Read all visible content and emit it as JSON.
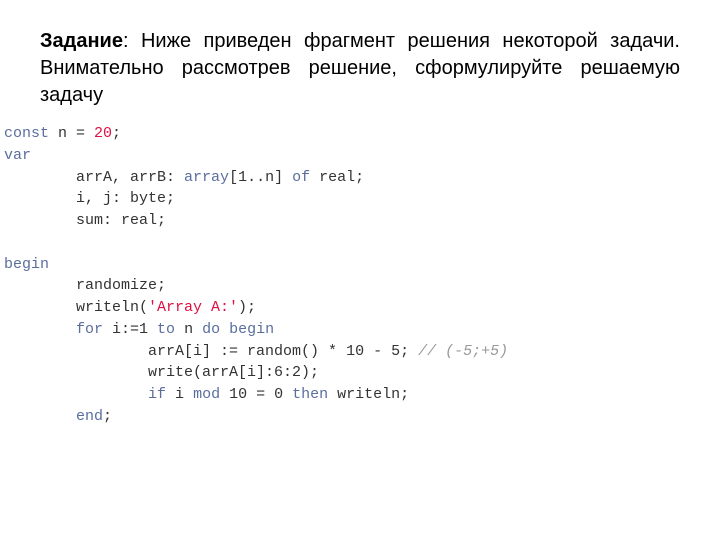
{
  "task": {
    "label": "Задание",
    "colon": ": ",
    "text": "Ниже приведен фрагмент решения некоторой задачи. Внимательно рассмотрев решение, сформулируйте решаемую задачу"
  },
  "code": {
    "l1": {
      "kw1": "const",
      "rest": " n = ",
      "num": "20",
      "semi": ";"
    },
    "l2": {
      "kw1": "var"
    },
    "l3": {
      "indent": "        ",
      "part1": "arrA, arrB: ",
      "kw1": "array",
      "part2": "[1..n] ",
      "kw2": "of",
      "part3": " real;"
    },
    "l4": {
      "indent": "        ",
      "part1": "i, j: byte;"
    },
    "l5": {
      "indent": "        ",
      "part1": "sum: real;"
    },
    "blank1": "",
    "l6": {
      "kw1": "begin"
    },
    "l7": {
      "indent": "        ",
      "part1": "randomize;"
    },
    "l8": {
      "indent": "        ",
      "part1": "writeln(",
      "str": "'Array A:'",
      "part2": ");"
    },
    "l9": {
      "indent": "        ",
      "kw1": "for",
      "part1": " i:=1 ",
      "kw2": "to",
      "part2": " n ",
      "kw3": "do",
      "part3": " ",
      "kw4": "begin"
    },
    "l10": {
      "indent": "                ",
      "part1": "arrA[i] := random() * 10 - 5; ",
      "cmt": "// (-5;+5)"
    },
    "l11": {
      "indent": "                ",
      "part1": "write(arrA[i]:6:2);"
    },
    "l12": {
      "indent": "                ",
      "kw1": "if",
      "part1": " i ",
      "kw2": "mod",
      "part2": " 10 = 0 ",
      "kw3": "then",
      "part3": " writeln;"
    },
    "l13": {
      "indent": "        ",
      "kw1": "end",
      "part1": ";"
    }
  }
}
